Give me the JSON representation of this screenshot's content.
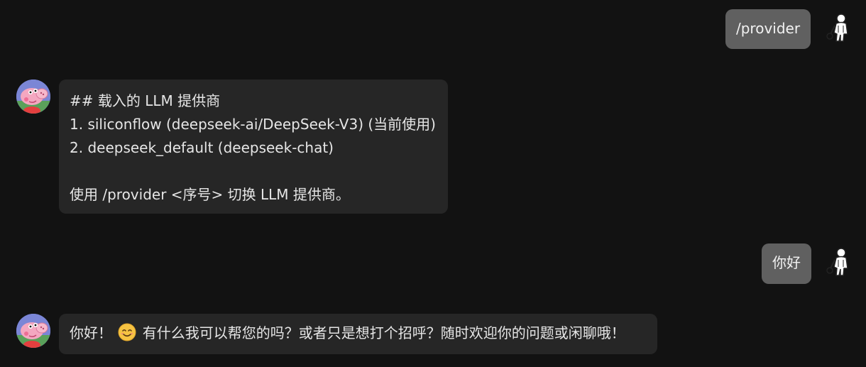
{
  "messages": [
    {
      "role": "user",
      "text": "/provider",
      "avatar_icon": "astronaut-icon"
    },
    {
      "role": "assistant",
      "avatar_icon": "peppa-pig-avatar",
      "lines": [
        "## 载入的 LLM 提供商",
        "1. siliconflow (deepseek-ai/DeepSeek-V3) (当前使用)",
        "2. deepseek_default (deepseek-chat)",
        "",
        "使用 /provider <序号> 切换 LLM 提供商。"
      ]
    },
    {
      "role": "user",
      "text": "你好",
      "avatar_icon": "astronaut-icon"
    },
    {
      "role": "assistant",
      "avatar_icon": "peppa-pig-avatar",
      "text_before_emoji": "你好！",
      "emoji": "smiling-face-emoji",
      "text_after_emoji": "有什么我可以帮您的吗？或者只是想打个招呼？随时欢迎你的问题或闲聊哦！"
    }
  ],
  "colors": {
    "background": "#121212",
    "user_bubble": "#606060",
    "assistant_bubble": "#262626",
    "text": "#e6e6e6"
  }
}
